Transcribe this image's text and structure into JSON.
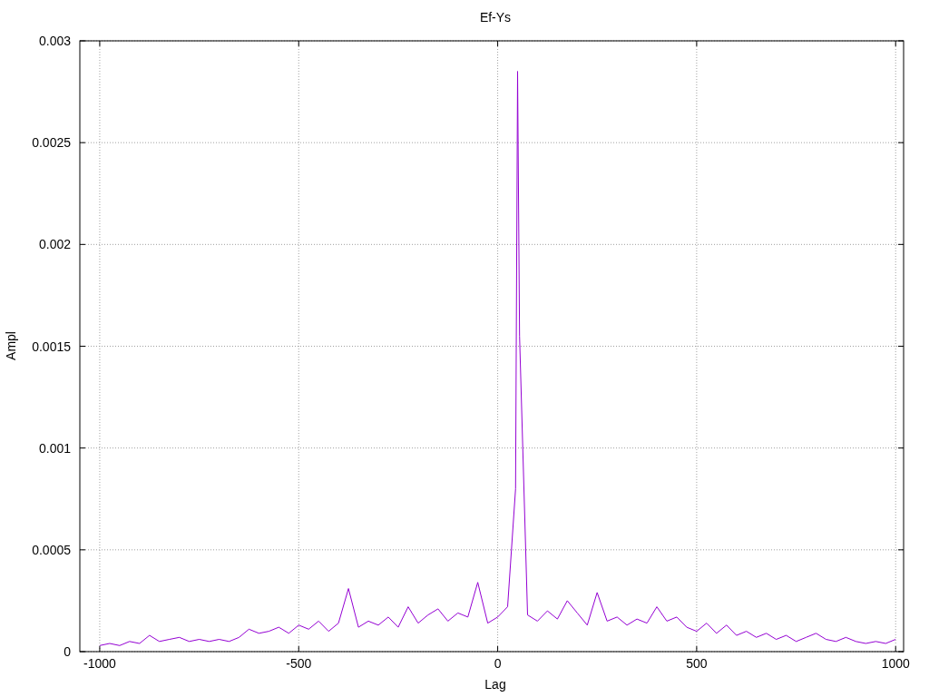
{
  "chart": {
    "chart_data": {
      "type": "line",
      "title": "Ef-Ys",
      "xlabel": "Lag",
      "ylabel": "Ampl",
      "xlim": [
        -1050,
        1020
      ],
      "ylim": [
        0,
        0.003
      ],
      "xticks": [
        -1000,
        -500,
        0,
        500,
        1000
      ],
      "yticks": [
        0,
        0.0005,
        0.001,
        0.0015,
        0.002,
        0.0025,
        0.003
      ],
      "x": [
        -1000,
        -975,
        -950,
        -925,
        -900,
        -875,
        -850,
        -825,
        -800,
        -775,
        -750,
        -725,
        -700,
        -675,
        -650,
        -625,
        -600,
        -575,
        -550,
        -525,
        -500,
        -475,
        -450,
        -425,
        -400,
        -375,
        -350,
        -325,
        -300,
        -275,
        -250,
        -225,
        -200,
        -175,
        -150,
        -125,
        -100,
        -75,
        -50,
        -25,
        0,
        25,
        45,
        50,
        55,
        75,
        100,
        125,
        150,
        175,
        200,
        225,
        250,
        275,
        300,
        325,
        350,
        375,
        400,
        425,
        450,
        475,
        500,
        525,
        550,
        575,
        600,
        625,
        650,
        675,
        700,
        725,
        750,
        775,
        800,
        825,
        850,
        875,
        900,
        925,
        950,
        975,
        1000
      ],
      "grid": true,
      "series": [
        {
          "color": "#9400d3",
          "values": [
            3e-05,
            4e-05,
            3e-05,
            5e-05,
            4e-05,
            8e-05,
            5e-05,
            6e-05,
            7e-05,
            5e-05,
            6e-05,
            5e-05,
            6e-05,
            5e-05,
            7e-05,
            0.00011,
            9e-05,
            0.0001,
            0.00012,
            9e-05,
            0.00013,
            0.00011,
            0.00015,
            0.0001,
            0.00014,
            0.00031,
            0.00012,
            0.00015,
            0.00013,
            0.00017,
            0.00012,
            0.00022,
            0.00014,
            0.00018,
            0.00021,
            0.00015,
            0.00019,
            0.00017,
            0.00034,
            0.00014,
            0.00017,
            0.00022,
            0.0008,
            0.00285,
            0.00155,
            0.00018,
            0.00015,
            0.0002,
            0.00016,
            0.00025,
            0.00019,
            0.00013,
            0.00029,
            0.00015,
            0.00017,
            0.00013,
            0.00016,
            0.00014,
            0.00022,
            0.00015,
            0.00017,
            0.00012,
            0.0001,
            0.00014,
            9e-05,
            0.00013,
            8e-05,
            0.0001,
            7e-05,
            9e-05,
            6e-05,
            8e-05,
            5e-05,
            7e-05,
            9e-05,
            6e-05,
            5e-05,
            7e-05,
            5e-05,
            4e-05,
            5e-05,
            4e-05,
            6e-05
          ]
        }
      ]
    }
  }
}
